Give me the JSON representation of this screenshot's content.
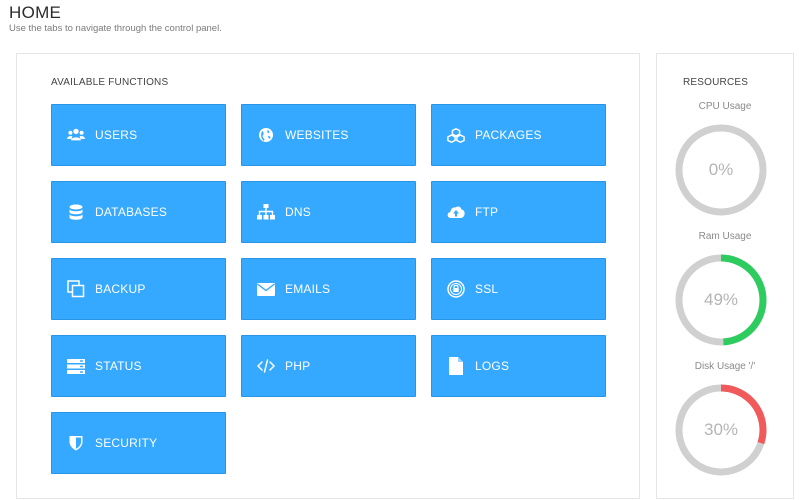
{
  "header": {
    "title": "HOME",
    "subtitle": "Use the tabs to navigate through the control panel."
  },
  "functions": {
    "title": "AVAILABLE FUNCTIONS",
    "items": [
      {
        "label": "USERS",
        "icon": "users-icon"
      },
      {
        "label": "WEBSITES",
        "icon": "globe-icon"
      },
      {
        "label": "PACKAGES",
        "icon": "cubes-icon"
      },
      {
        "label": "DATABASES",
        "icon": "database-icon"
      },
      {
        "label": "DNS",
        "icon": "sitemap-icon"
      },
      {
        "label": "FTP",
        "icon": "cloud-upload-icon"
      },
      {
        "label": "BACKUP",
        "icon": "copy-icon"
      },
      {
        "label": "EMAILS",
        "icon": "envelope-icon"
      },
      {
        "label": "SSL",
        "icon": "lock-icon"
      },
      {
        "label": "STATUS",
        "icon": "server-icon"
      },
      {
        "label": "PHP",
        "icon": "code-icon"
      },
      {
        "label": "LOGS",
        "icon": "file-icon"
      },
      {
        "label": "SECURITY",
        "icon": "shield-icon"
      }
    ]
  },
  "resources": {
    "title": "RESOURCES",
    "gauges": [
      {
        "label": "CPU Usage",
        "value_text": "0%",
        "percent": 0,
        "color": "#2ecc5f"
      },
      {
        "label": "Ram Usage",
        "value_text": "49%",
        "percent": 49,
        "color": "#2ecc5f"
      },
      {
        "label": "Disk Usage '/'",
        "value_text": "30%",
        "percent": 30,
        "color": "#f15a5a"
      }
    ]
  },
  "colors": {
    "tile_bg": "#35a8ff",
    "gauge_track": "#d0d0d0"
  }
}
